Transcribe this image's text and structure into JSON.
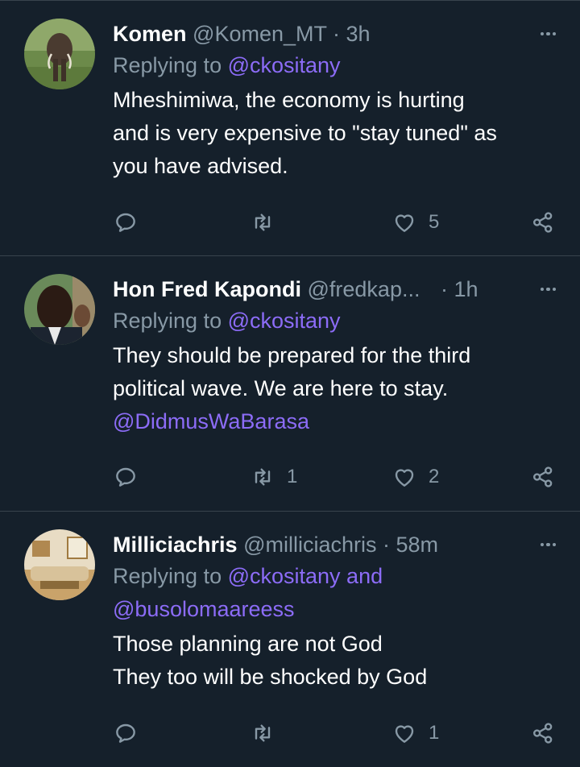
{
  "tweets": [
    {
      "name": "Komen",
      "handle": "@Komen_MT",
      "time": "· 3h",
      "replying_prefix": "Replying to ",
      "replying_to": "@ckositany",
      "replying_extra": "",
      "body_lines": [
        "Mheshimiwa, the economy is hurting",
        "and is very expensive to \"stay tuned\" as",
        "you have advised."
      ],
      "mention": "",
      "reply_count": "",
      "retweet_count": "",
      "like_count": "5",
      "avatar": "elephant-photo"
    },
    {
      "name": "Hon Fred Kapondi",
      "handle": "@fredkap...",
      "time": "· 1h",
      "replying_prefix": "Replying to ",
      "replying_to": "@ckositany",
      "replying_extra": "",
      "body_lines": [
        "They should be prepared for the third",
        "political wave. We are here to stay."
      ],
      "mention": "@DidmusWaBarasa",
      "reply_count": "",
      "retweet_count": "1",
      "like_count": "2",
      "avatar": "man-portrait-photo"
    },
    {
      "name": "Milliciachris",
      "handle": "@milliciachris",
      "time": "· 58m",
      "replying_prefix": "Replying to ",
      "replying_to": "@ckositany and",
      "replying_extra": "@busolomaareess",
      "body_lines": [
        "Those planning are not God",
        "They too will be shocked by God"
      ],
      "mention": "",
      "reply_count": "",
      "retweet_count": "",
      "like_count": "1",
      "avatar": "living-room-photo"
    }
  ],
  "icons": {
    "reply": "reply-icon",
    "retweet": "retweet-icon",
    "like": "heart-icon",
    "share": "share-icon",
    "more": "more-dots-icon"
  },
  "colors": {
    "background": "#15202b",
    "divider": "#38444d",
    "muted_text": "#8899a6",
    "link": "#8c6cf7",
    "text": "#ffffff"
  }
}
